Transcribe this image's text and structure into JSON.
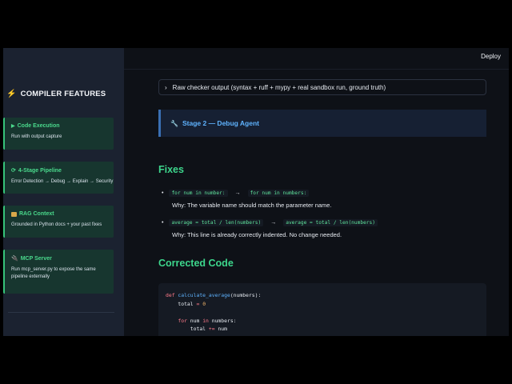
{
  "topbar": {
    "deploy_label": "Deploy"
  },
  "sidebar": {
    "title": "COMPILER FEATURES",
    "items": [
      {
        "icon": "play-icon",
        "title": "Code Execution",
        "desc": [
          "Run with output capture"
        ]
      },
      {
        "icon": "cycle-icon",
        "title": "4-Stage Pipeline",
        "desc": [
          "Error Detection → Debug → Explain → Security"
        ]
      },
      {
        "icon": "books-icon",
        "title": "RAG Context",
        "desc": [
          "Grounded in Python docs + your past fixes"
        ]
      },
      {
        "icon": "plug-icon",
        "title": "MCP Server",
        "desc": [
          "Run mcp_server.py to expose the same",
          "pipeline externally"
        ]
      }
    ]
  },
  "main": {
    "expander_label": "Raw checker output (syntax + ruff + mypy + real sandbox run, ground truth)",
    "stage_label": "Stage 2 — Debug Agent",
    "fixes_heading": "Fixes",
    "fixes": [
      {
        "from": "for num in number:",
        "to": "for num in numbers:",
        "why": "Why: The variable name should match the parameter name."
      },
      {
        "from": "average = total / len(numbers)",
        "to": "average = total / len(numbers)",
        "why": "Why: This line is already correctly indented. No change needed."
      }
    ],
    "corrected_heading": "Corrected Code",
    "code": {
      "l1_kw": "def",
      "l1_fn": "calculate_average",
      "l1_rest": "(numbers):",
      "l2_var": "total",
      "l2_op": " = ",
      "l2_num": "0",
      "l4_kw1": "for",
      "l4_var": " num ",
      "l4_kw2": "in",
      "l4_rest": " numbers:",
      "l5_var": "total",
      "l5_op": " += ",
      "l5_rest": "num"
    }
  },
  "colors": {
    "accent_green": "#3dd68c",
    "accent_blue": "#5fb3ff",
    "sidebar_bg": "#1b2230",
    "main_bg": "#0e1117"
  }
}
